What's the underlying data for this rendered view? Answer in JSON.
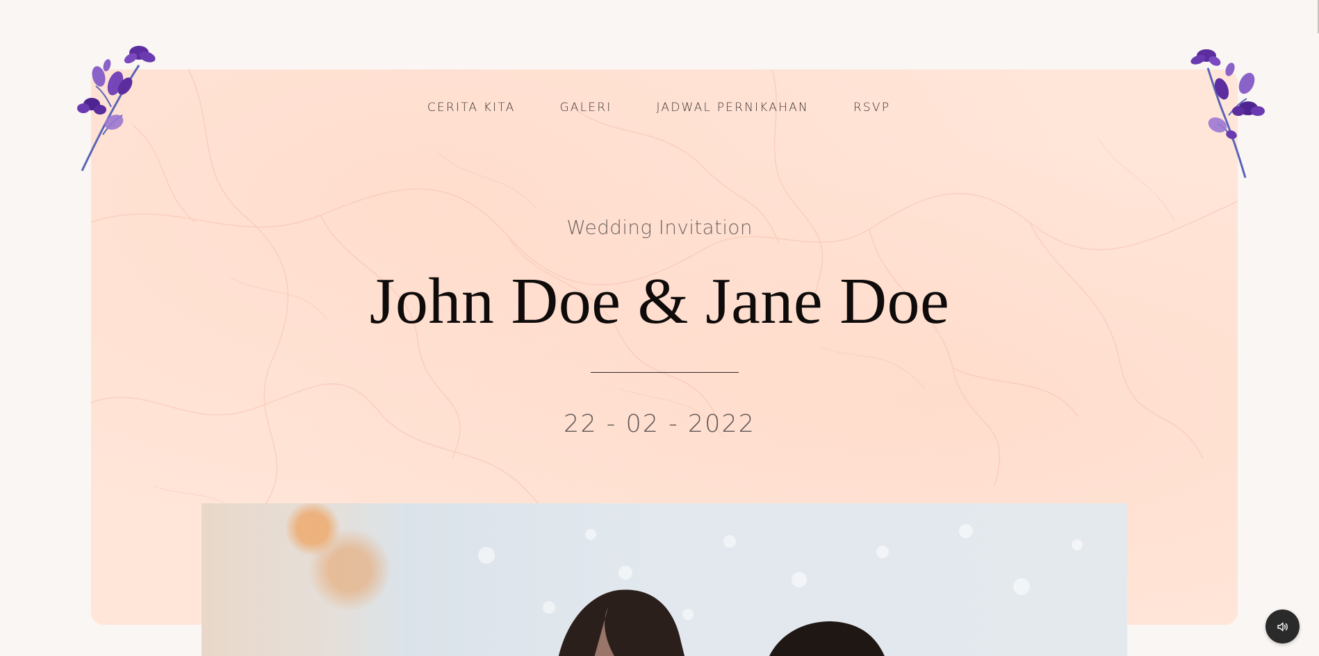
{
  "nav": {
    "items": [
      {
        "label": "CERITA KITA"
      },
      {
        "label": "GALERI"
      },
      {
        "label": "JADWAL PERNIKAHAN"
      },
      {
        "label": "RSVP"
      }
    ]
  },
  "hero": {
    "subtitle": "Wedding Invitation",
    "couple_names": "John Doe & Jane Doe",
    "date": "22 - 02 - 2022"
  },
  "icons": {
    "left_decoration": "lavender-flower-icon",
    "right_decoration": "lavender-flower-icon",
    "audio": "speaker-icon"
  },
  "colors": {
    "background": "#faf6f3",
    "card": "#ffe6d9",
    "text_dark": "#0e0b0a",
    "flower_purple": "#6a3bb0",
    "audio_button": "#2a2a2a"
  }
}
